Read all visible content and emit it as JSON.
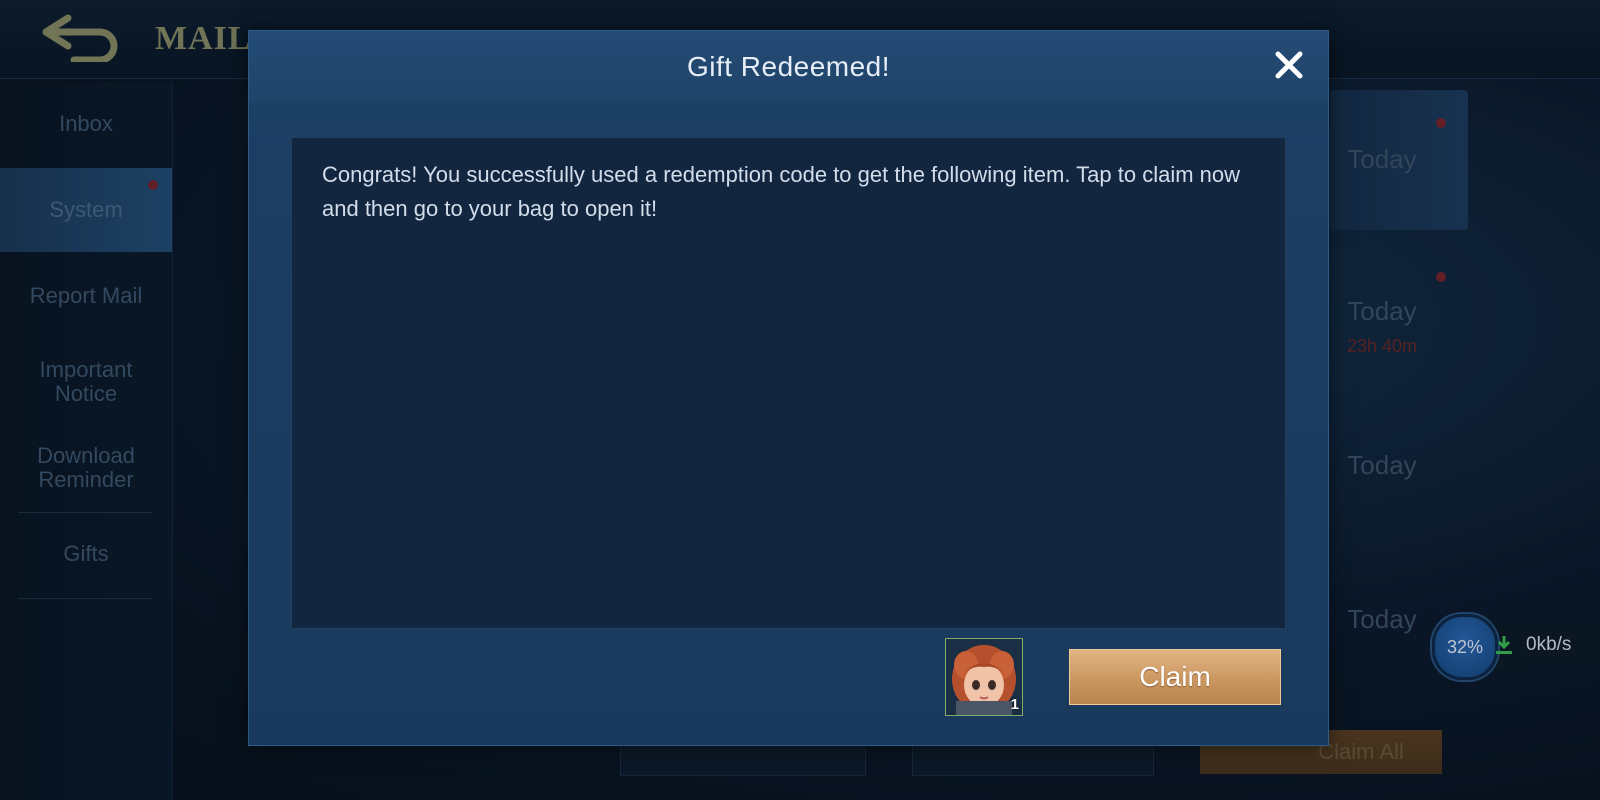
{
  "topbar": {
    "title": "MAIL"
  },
  "sidebar": {
    "items": [
      {
        "label": "Inbox"
      },
      {
        "label": "System"
      },
      {
        "label": "Report Mail"
      },
      {
        "label": "Important Notice"
      },
      {
        "label": "Download Reminder"
      },
      {
        "label": "Gifts"
      }
    ]
  },
  "mail_list": [
    {
      "date": "Today",
      "timer": ""
    },
    {
      "date": "Today",
      "timer": "23h 40m"
    },
    {
      "date": "Today",
      "timer": ""
    },
    {
      "date": "Today",
      "timer": ""
    }
  ],
  "footer": {
    "claim_all_label": "Claim All"
  },
  "download": {
    "percent": "32%",
    "speed": "0kb/s"
  },
  "dialog": {
    "title": "Gift Redeemed!",
    "message": "Congrats! You successfully used a redemption code to get the following item. Tap to claim now and then go to your bag to open it!",
    "item": {
      "count": "1",
      "icon": "hero-avatar-icon"
    },
    "claim_label": "Claim"
  },
  "colors": {
    "accent_gold": "#c9955e",
    "dialog_bg": "#1b3c60",
    "unread_dot": "#7a2530"
  }
}
